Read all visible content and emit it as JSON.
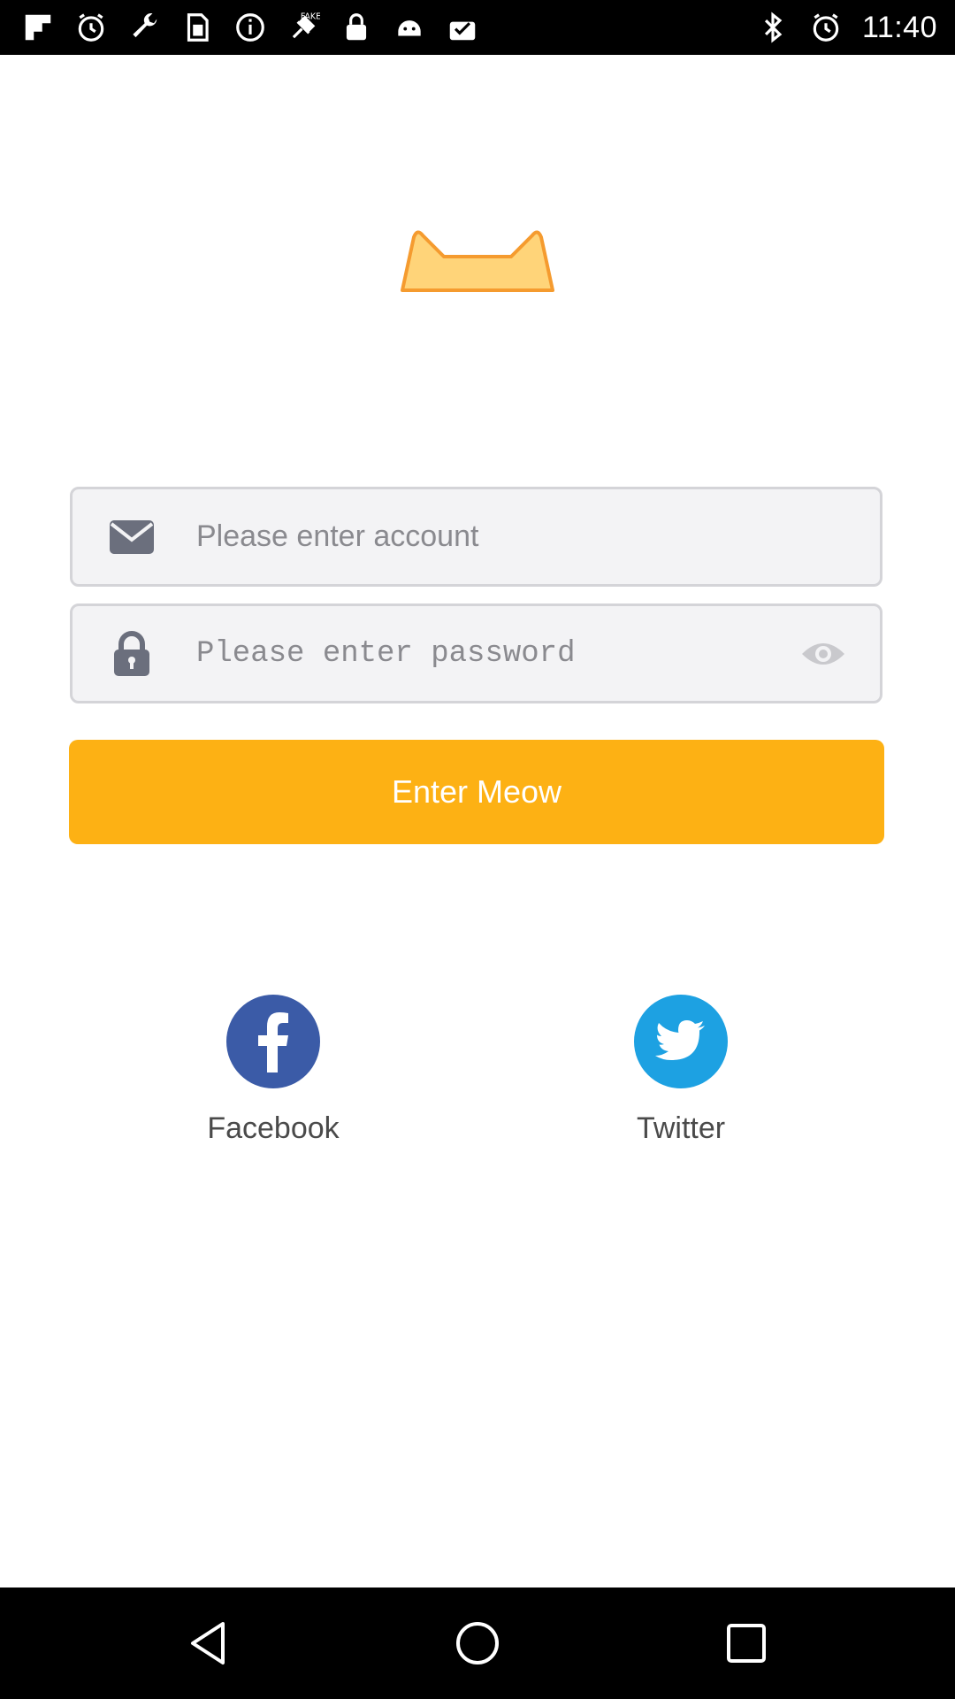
{
  "status_bar": {
    "time": "11:40",
    "left_icons": [
      "flipboard-icon",
      "alarm-clock-icon",
      "wrench-icon",
      "sim-card-icon",
      "info-icon",
      "fake-gps-icon",
      "lock-icon",
      "android-icon",
      "clipboard-check-icon"
    ],
    "right_icons": [
      "bluetooth-icon",
      "alarm-icon"
    ]
  },
  "logo": {
    "icon": "cat-ears-logo",
    "fill_color": "#ffd479",
    "stroke_color": "#f59b2f"
  },
  "login_form": {
    "account_field": {
      "placeholder": "Please enter account",
      "value": "",
      "icon": "envelope-icon"
    },
    "password_field": {
      "placeholder": "Please enter password",
      "value": "",
      "icon": "padlock-icon",
      "toggle_icon": "eye-icon"
    },
    "submit_label": "Enter Meow",
    "submit_color": "#fdb114"
  },
  "social_login": {
    "facebook": {
      "label": "Facebook",
      "icon": "facebook-icon",
      "color": "#3b5ba7"
    },
    "twitter": {
      "label": "Twitter",
      "icon": "twitter-icon",
      "color": "#1da1e2"
    }
  },
  "nav_bar": {
    "buttons": [
      "back-icon",
      "home-icon",
      "recents-icon"
    ]
  }
}
